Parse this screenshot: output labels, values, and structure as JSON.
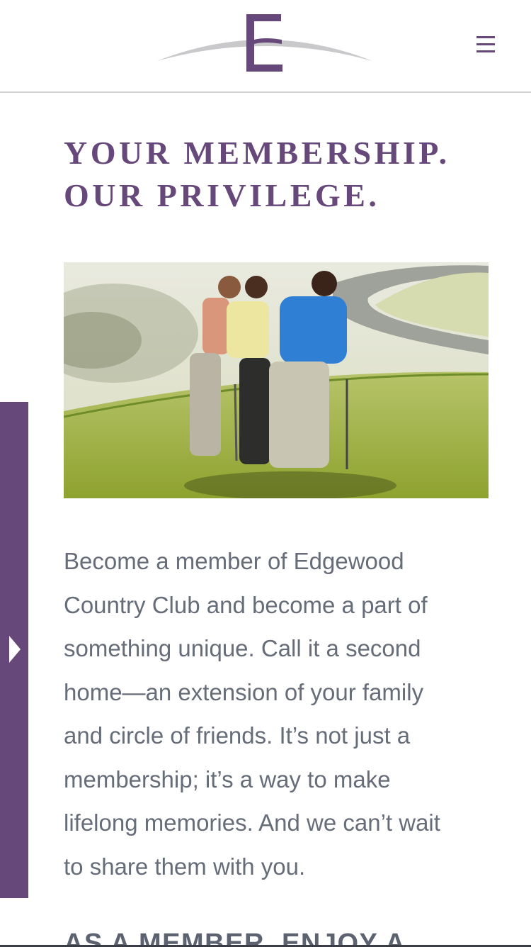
{
  "header": {
    "logo_icon": "edgewood-e-logo",
    "menu_icon": "hamburger-menu-icon"
  },
  "headline": {
    "line1": "YOUR MEMBERSHIP.",
    "line2": "OUR PRIVILEGE."
  },
  "hero_image": {
    "subject": "golfers-on-green-photo"
  },
  "side_tab": {
    "icon": "caret-right-icon"
  },
  "intro": {
    "lines": [
      "Become a member of Edgewood",
      "Country Club and become a part of",
      "something unique. Call it a second",
      "home—an extension of your family",
      "and circle of friends. It’s not just a",
      "membership; it’s a way to make",
      "lifelong memories. And we can’t wait",
      "to share them with you."
    ]
  },
  "subheading": "AS A MEMBER, ENJOY A",
  "colors": {
    "brand_purple": "#67487a",
    "body_text": "#666c78",
    "divider": "#d3d3d6"
  }
}
